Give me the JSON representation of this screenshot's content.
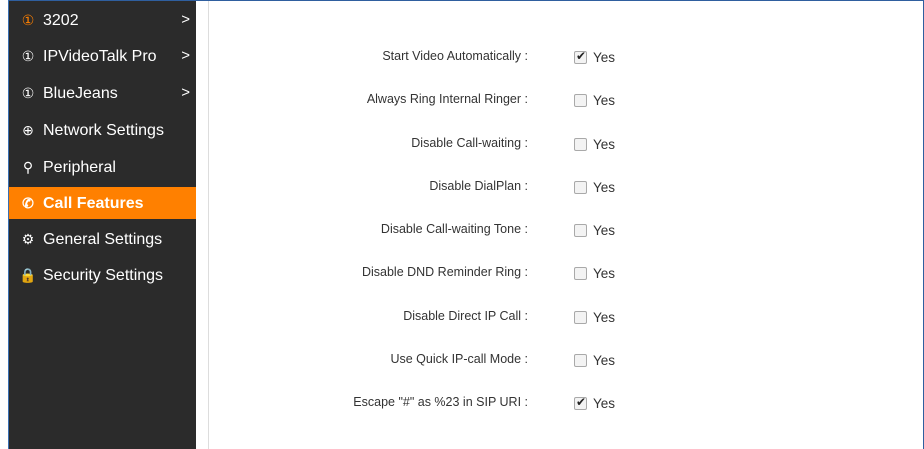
{
  "sidebar": {
    "items": [
      {
        "label": "3202",
        "icon": "account-icon",
        "icon_glyph": "①",
        "has_chevron": true,
        "active": false,
        "icon_color": "#ff8000"
      },
      {
        "label": "IPVideoTalk Pro",
        "icon": "account-icon",
        "icon_glyph": "①",
        "has_chevron": true,
        "active": false
      },
      {
        "label": "BlueJeans",
        "icon": "account-icon",
        "icon_glyph": "①",
        "has_chevron": true,
        "active": false
      },
      {
        "label": "Network Settings",
        "icon": "globe-icon",
        "icon_glyph": "⊕",
        "has_chevron": false,
        "active": false
      },
      {
        "label": "Peripheral",
        "icon": "peripheral-icon",
        "icon_glyph": "⚲",
        "has_chevron": false,
        "active": false
      },
      {
        "label": "Call Features",
        "icon": "phone-icon",
        "icon_glyph": "✆",
        "has_chevron": false,
        "active": true
      },
      {
        "label": "General Settings",
        "icon": "gear-icon",
        "icon_glyph": "⚙",
        "has_chevron": false,
        "active": false
      },
      {
        "label": "Security Settings",
        "icon": "lock-icon",
        "icon_glyph": "🔒",
        "has_chevron": false,
        "active": false
      }
    ],
    "chevron": ">"
  },
  "settings": [
    {
      "label": "Start Video Automatically :",
      "checked": true,
      "option": "Yes"
    },
    {
      "label": "Always Ring Internal Ringer :",
      "checked": false,
      "option": "Yes"
    },
    {
      "label": "Disable Call-waiting :",
      "checked": false,
      "option": "Yes"
    },
    {
      "label": "Disable DialPlan :",
      "checked": false,
      "option": "Yes"
    },
    {
      "label": "Disable Call-waiting Tone :",
      "checked": false,
      "option": "Yes"
    },
    {
      "label": "Disable DND Reminder Ring :",
      "checked": false,
      "option": "Yes"
    },
    {
      "label": "Disable Direct IP Call :",
      "checked": false,
      "option": "Yes"
    },
    {
      "label": "Use Quick IP-call Mode :",
      "checked": false,
      "option": "Yes"
    },
    {
      "label": "Escape \"#\" as %23 in SIP URI :",
      "checked": true,
      "option": "Yes"
    }
  ],
  "colors": {
    "sidebar_bg": "#2b2b2b",
    "active_bg": "#ff8000",
    "accent": "#ff8000"
  }
}
